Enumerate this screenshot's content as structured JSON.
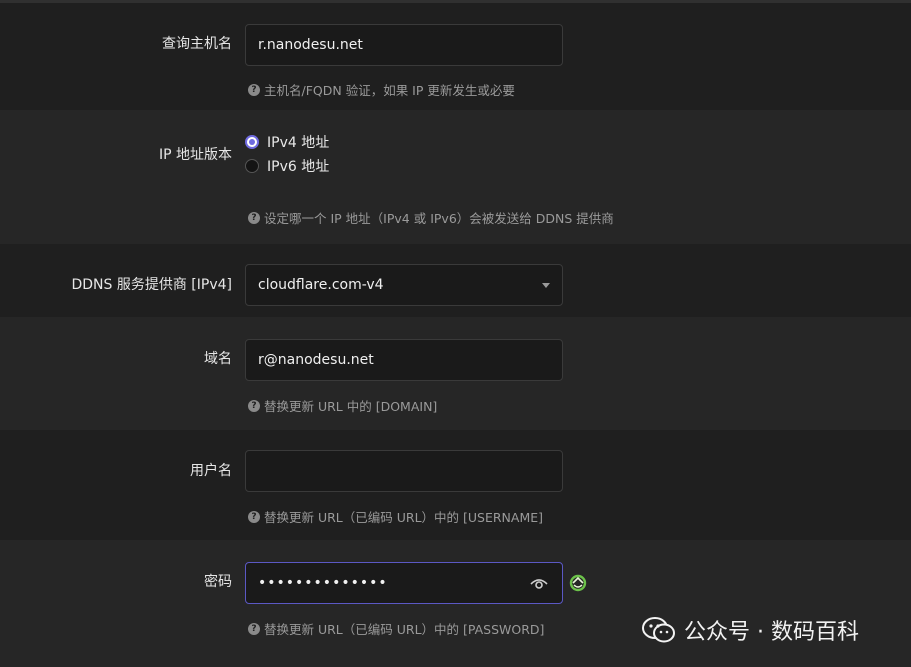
{
  "hostname": {
    "label": "查询主机名",
    "value": "r.nanodesu.net",
    "hint": "主机名/FQDN 验证，如果 IP 更新发生或必要"
  },
  "ip_version": {
    "label": "IP 地址版本",
    "options": [
      "IPv4 地址",
      "IPv6 地址"
    ],
    "selected": "IPv4 地址",
    "hint": "设定哪一个 IP 地址（IPv4 或 IPv6）会被发送给 DDNS 提供商"
  },
  "provider": {
    "label": "DDNS 服务提供商 [IPv4]",
    "value": "cloudflare.com-v4"
  },
  "domain": {
    "label": "域名",
    "value": "r@nanodesu.net",
    "hint": "替换更新 URL 中的 [DOMAIN]"
  },
  "username": {
    "label": "用户名",
    "value": "",
    "hint": "替换更新 URL（已编码 URL）中的 [USERNAME]"
  },
  "password": {
    "label": "密码",
    "value": "••••••••••••••",
    "hint": "替换更新 URL（已编码 URL）中的 [PASSWORD]"
  },
  "watermark": {
    "text": "公众号 · 数码百科"
  },
  "icons": {
    "hint": "question-circle-icon",
    "reveal": "eye-icon",
    "refresh": "refresh-icon",
    "select": "chevron-down-icon",
    "watermark": "wechat-logo-icon"
  },
  "colors": {
    "accent": "#6f6ae0",
    "focus_border": "#5b58c4",
    "refresh_green": "#6cc24a"
  }
}
